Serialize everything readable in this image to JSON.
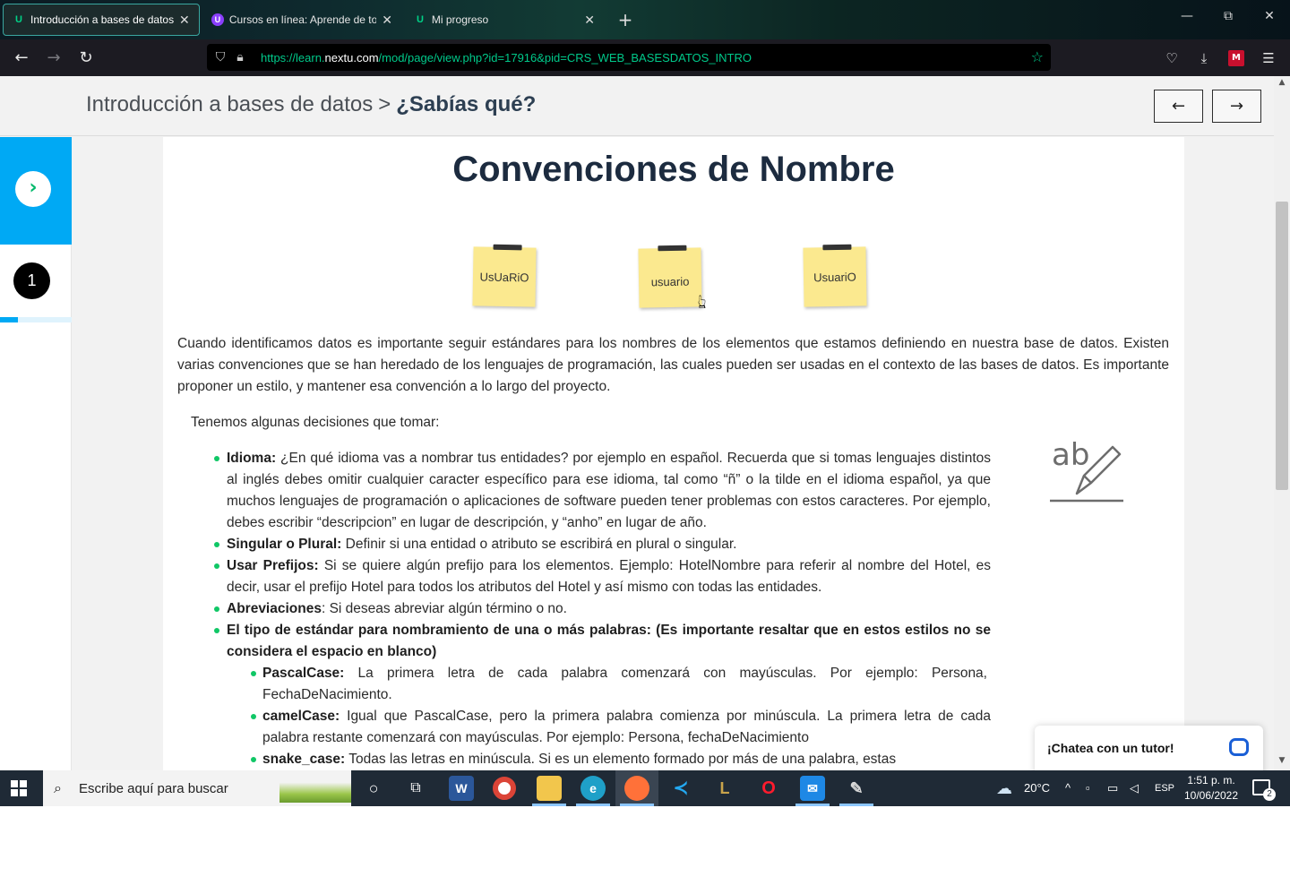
{
  "browser": {
    "tabs": [
      {
        "title": "Introducción a bases de datos: ¿Sabías qué?",
        "favicon": "U",
        "active": true
      },
      {
        "title": "Cursos en línea: Aprende de todo",
        "favicon": "U",
        "active": false
      },
      {
        "title": "Mi progreso",
        "favicon": "U",
        "active": false
      }
    ],
    "url_scheme": "https://learn.",
    "url_host": "nextu.com",
    "url_path": "/mod/page/view.php?id=17916&pid=CRS_WEB_BASESDATOS_INTRO",
    "new_tab_symbol": "+",
    "window_controls": {
      "minimize": "—",
      "restore": "⧉",
      "close": "✕"
    }
  },
  "header": {
    "course": "Introducción a bases de datos",
    "separator": ">",
    "section": "¿Sabías qué?",
    "prev_symbol": "←",
    "next_symbol": "→"
  },
  "sidebar": {
    "step_number": "1",
    "progress": 0.25
  },
  "content": {
    "title": "Convenciones de Nombre",
    "notes": [
      "UsUaRiO",
      "usuario",
      "UsuariO"
    ],
    "intro": "Cuando identificamos datos es importante seguir estándares para los nombres de los elementos que estamos definiendo en nuestra base de datos. Existen varias convenciones que se han heredado de los lenguajes de programación, las cuales pueden ser usadas en el contexto de las bases de datos. Es importante proponer un estilo, y mantener esa convención a lo largo del proyecto.",
    "decisions_intro": "Tenemos algunas decisiones que tomar:",
    "items": [
      {
        "label": "Idioma:",
        "text": " ¿En qué idioma vas a nombrar tus entidades? por ejemplo en español. Recuerda que si tomas lenguajes distintos al inglés debes omitir cualquier caracter específico para ese idioma, tal como “ñ” o la tilde en el idioma español, ya que muchos lenguajes de programación o aplicaciones de software pueden tener problemas con estos caracteres. Por ejemplo, debes escribir “descripcion” en lugar de descripción, y “anho” en lugar de año."
      },
      {
        "label": "Singular o Plural:",
        "text": " Definir si una entidad o atributo se escribirá en plural o singular."
      },
      {
        "label": "Usar Prefijos:",
        "text": " Si se quiere algún prefijo para los elementos. Ejemplo: HotelNombre para referir al nombre del Hotel, es decir, usar el prefijo Hotel para todos los atributos del Hotel y así mismo con todas las entidades."
      },
      {
        "label": "Abreviaciones",
        "text": ": Si deseas abreviar algún término o no."
      },
      {
        "label": "El tipo de estándar para nombramiento de una o más palabras: (Es importante resaltar que en estos estilos no se considera el espacio en blanco)",
        "text": ""
      }
    ],
    "subitems": [
      {
        "label": "PascalCase:",
        "text": " La primera letra de cada palabra comenzará con mayúsculas. Por ejemplo: Persona, FechaDeNacimiento."
      },
      {
        "label": "camelCase:",
        "text": " Igual que PascalCase, pero la primera palabra comienza por minúscula. La primera letra de cada palabra restante comenzará con mayúsculas. Por ejemplo: Persona, fechaDeNacimiento"
      },
      {
        "label": "snake_case:",
        "text": " Todas las letras en minúscula. Si es un elemento formado por más de una palabra, estas"
      }
    ],
    "illustration_text": "ab"
  },
  "chat": {
    "label": "¡Chatea con un tutor!"
  },
  "taskbar": {
    "search_placeholder": "Escribe aquí para buscar",
    "weather": "20°C",
    "language": "ESP",
    "time": "1:51 p. m.",
    "date": "10/06/2022",
    "notifications": "2"
  }
}
